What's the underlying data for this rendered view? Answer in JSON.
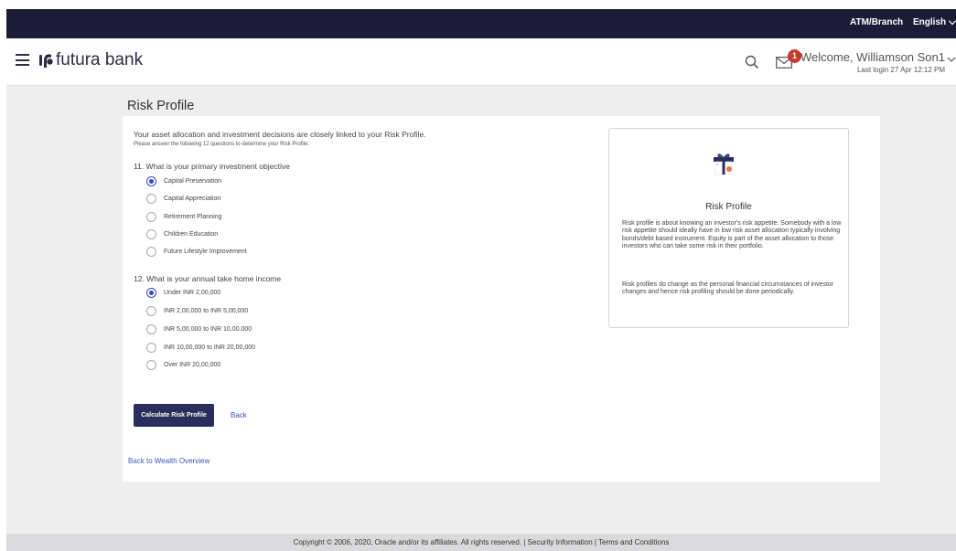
{
  "topbar": {
    "atm_branch": "ATM/Branch",
    "language": "English"
  },
  "header": {
    "brand": "futura bank",
    "notification_count": "1",
    "welcome": "Welcome, Williamson Son1",
    "last_login": "Last login 27 Apr 12:12 PM"
  },
  "page": {
    "title": "Risk Profile",
    "intro": "Your asset allocation and investment decisions are closely linked to your Risk Profile.",
    "instruction": "Please answer the following 12 questions to determine your Risk Profile."
  },
  "questions": [
    {
      "text": "11. What is your primary investment objective",
      "options": [
        "Capital Preservation",
        "Capital Appreciation",
        "Retirement Planning",
        "Children Education",
        "Future Lifestyle Improvement"
      ],
      "selected": 0
    },
    {
      "text": "12. What is your annual take home income",
      "options": [
        "Under INR 2,00,000",
        "INR 2,00,000 to INR 5,00,000",
        "INR 5,00,000 to INR 10,00,000",
        "INR 10,00,000 to INR 20,00,000",
        "Over INR 20,00,000"
      ],
      "selected": 0
    }
  ],
  "actions": {
    "calculate": "Calculate Risk Profile",
    "back": "Back",
    "back_to_wealth": "Back to Wealth Overview"
  },
  "info_card": {
    "icon": "gift-icon",
    "title": "Risk Profile",
    "paragraph1": "Risk profile is about knowing an investor's risk appetite. Somebody with a low risk appetite should ideally have in low risk asset allocation typically involving bonds/debt based instrument. Equity is part of the asset allocation to those investors who can take some risk in their portfolio.",
    "paragraph2": "Risk profiles do change as the personal financial circumstances of investor changes and hence risk profiling should be done periodically."
  },
  "footer": {
    "copyright": "Copyright © 2006, 2020, Oracle and/or its affiliates. All rights reserved. | Security Information | Terms and Conditions"
  },
  "colors": {
    "topbar": "#1c1c38",
    "primary_button": "#2b2e5c",
    "radio_selected": "#3a47bd",
    "badge": "#c73a2c",
    "link": "#3a56c4"
  }
}
